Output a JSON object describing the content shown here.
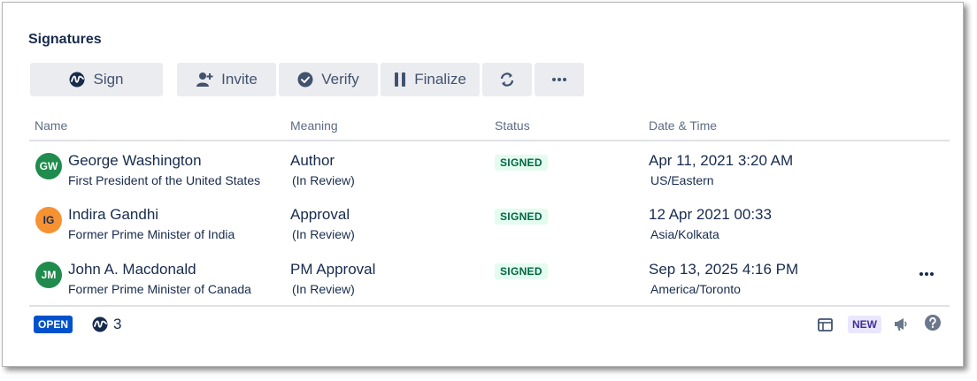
{
  "section": {
    "title": "Signatures"
  },
  "toolbar": {
    "sign_label": "Sign",
    "invite_label": "Invite",
    "verify_label": "Verify",
    "finalize_label": "Finalize",
    "refresh_icon": "refresh-icon",
    "more_icon": "more-horizontal-icon"
  },
  "table": {
    "headers": [
      "Name",
      "Meaning",
      "Status",
      "Date & Time"
    ],
    "rows": [
      {
        "initials": "GW",
        "avatar_color": "#1f8b4c",
        "name": "George Washington",
        "title": "First President of the United States",
        "meaning": "Author",
        "meaning_note": "(In Review)",
        "status": "SIGNED",
        "date": "Apr 11, 2021 3:20 AM",
        "timezone": "US/Eastern"
      },
      {
        "initials": "IG",
        "avatar_color": "#f79232",
        "name": "Indira Gandhi",
        "title": "Former Prime Minister of India",
        "meaning": "Approval",
        "meaning_note": "(In Review)",
        "status": "SIGNED",
        "date": "12 Apr 2021 00:33",
        "timezone": "Asia/Kolkata"
      },
      {
        "initials": "JM",
        "avatar_color": "#1f8b4c",
        "name": "John A. Macdonald",
        "title": "Former Prime Minister of Canada",
        "meaning": "PM Approval",
        "meaning_note": "(In Review)",
        "status": "SIGNED",
        "date": "Sep 13, 2025 4:16 PM",
        "timezone": "America/Toronto"
      }
    ]
  },
  "footer": {
    "status_badge": "OPEN",
    "signature_count": "3",
    "new_badge": "NEW"
  },
  "colors": {
    "button_bg": "#ebecf0",
    "signed_bg": "#e3fcef",
    "signed_text": "#006644",
    "open_bg": "#0052cc",
    "new_bg": "#eae6ff"
  }
}
